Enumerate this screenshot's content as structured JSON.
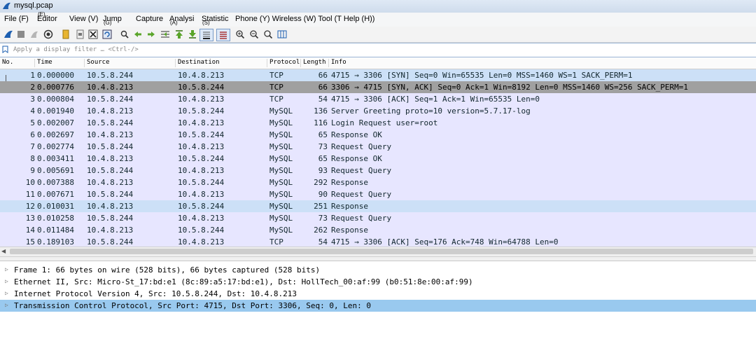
{
  "window": {
    "title": "mysql.pcap",
    "icon": "wireshark-fin-icon"
  },
  "menu": [
    {
      "label": "File (F)",
      "sub": ""
    },
    {
      "label": "Editor",
      "sub": "(E)"
    },
    {
      "label": "View (V)",
      "sub": ""
    },
    {
      "label": "Jump",
      "sub": "(G)"
    },
    {
      "label": "Capture",
      "sub": ""
    },
    {
      "label": "Analysi",
      "sub": "(A)"
    },
    {
      "label": "Statistic",
      "sub": "(S)"
    },
    {
      "label": "Phone (Y) Wireless (W) Tool (T Help (H))",
      "sub": ""
    }
  ],
  "toolbar": {
    "icons": [
      "shark-fin-icon",
      "stop-icon",
      "restart-icon",
      "capture-options-icon",
      "open-folder-icon",
      "file-icon",
      "close-file-icon",
      "reload-icon",
      "find-icon",
      "go-back-icon",
      "go-forward-icon",
      "go-to-packet-icon",
      "first-packet-icon",
      "last-packet-icon",
      "auto-scroll-icon",
      "colorize-icon",
      "zoom-in-icon",
      "zoom-out-icon",
      "normal-size-icon",
      "resize-columns-icon"
    ]
  },
  "filter": {
    "placeholder": "Apply a display filter … <Ctrl-/>",
    "value": ""
  },
  "packet_list": {
    "columns": {
      "no": "No.",
      "time": "Time",
      "source": "Source",
      "destination": "Destination",
      "protocol": "Protocol",
      "length": "Length",
      "info": "Info"
    },
    "rows": [
      {
        "no": "1",
        "time": "0.000000",
        "src": "10.5.8.244",
        "dst": "10.4.8.213",
        "proto": "TCP",
        "len": "66",
        "info": "4715 → 3306 [SYN] Seq=0 Win=65535 Len=0 MSS=1460 WS=1 SACK_PERM=1"
      },
      {
        "no": "2",
        "time": "0.000776",
        "src": "10.4.8.213",
        "dst": "10.5.8.244",
        "proto": "TCP",
        "len": "66",
        "info": "3306 → 4715 [SYN, ACK] Seq=0 Ack=1 Win=8192 Len=0 MSS=1460 WS=256 SACK_PERM=1"
      },
      {
        "no": "3",
        "time": "0.000804",
        "src": "10.5.8.244",
        "dst": "10.4.8.213",
        "proto": "TCP",
        "len": "54",
        "info": "4715 → 3306 [ACK] Seq=1 Ack=1 Win=65535 Len=0"
      },
      {
        "no": "4",
        "time": "0.001940",
        "src": "10.4.8.213",
        "dst": "10.5.8.244",
        "proto": "MySQL",
        "len": "136",
        "info": "Server Greeting proto=10 version=5.7.17-log"
      },
      {
        "no": "5",
        "time": "0.002007",
        "src": "10.5.8.244",
        "dst": "10.4.8.213",
        "proto": "MySQL",
        "len": "116",
        "info": "Login Request user=root"
      },
      {
        "no": "6",
        "time": "0.002697",
        "src": "10.4.8.213",
        "dst": "10.5.8.244",
        "proto": "MySQL",
        "len": "65",
        "info": "Response OK"
      },
      {
        "no": "7",
        "time": "0.002774",
        "src": "10.5.8.244",
        "dst": "10.4.8.213",
        "proto": "MySQL",
        "len": "73",
        "info": "Request Query"
      },
      {
        "no": "8",
        "time": "0.003411",
        "src": "10.4.8.213",
        "dst": "10.5.8.244",
        "proto": "MySQL",
        "len": "65",
        "info": "Response OK"
      },
      {
        "no": "9",
        "time": "0.005691",
        "src": "10.5.8.244",
        "dst": "10.4.8.213",
        "proto": "MySQL",
        "len": "93",
        "info": "Request Query"
      },
      {
        "no": "10",
        "time": "0.007388",
        "src": "10.4.8.213",
        "dst": "10.5.8.244",
        "proto": "MySQL",
        "len": "292",
        "info": "Response"
      },
      {
        "no": "11",
        "time": "0.007671",
        "src": "10.5.8.244",
        "dst": "10.4.8.213",
        "proto": "MySQL",
        "len": "90",
        "info": "Request Query"
      },
      {
        "no": "12",
        "time": "0.010031",
        "src": "10.4.8.213",
        "dst": "10.5.8.244",
        "proto": "MySQL",
        "len": "251",
        "info": "Response"
      },
      {
        "no": "13",
        "time": "0.010258",
        "src": "10.5.8.244",
        "dst": "10.4.8.213",
        "proto": "MySQL",
        "len": "73",
        "info": "Request Query"
      },
      {
        "no": "14",
        "time": "0.011484",
        "src": "10.4.8.213",
        "dst": "10.5.8.244",
        "proto": "MySQL",
        "len": "262",
        "info": "Response"
      },
      {
        "no": "15",
        "time": "0.189103",
        "src": "10.5.8.244",
        "dst": "10.4.8.213",
        "proto": "TCP",
        "len": "54",
        "info": "4715 → 3306 [ACK] Seq=176 Ack=748 Win=64788 Len=0"
      }
    ],
    "selected_row": "2"
  },
  "details": [
    {
      "text": "Frame 1: 66 bytes on wire (528 bits), 66 bytes captured (528 bits)"
    },
    {
      "text": "Ethernet II, Src: Micro-St_17:bd:e1 (8c:89:a5:17:bd:e1), Dst: HollTech_00:af:99 (b0:51:8e:00:af:99)"
    },
    {
      "text": "Internet Protocol Version 4, Src: 10.5.8.244, Dst: 10.4.8.213"
    },
    {
      "text": "Transmission Control Protocol, Src Port: 4715, Dst Port: 3306, Seq: 0, Len: 0"
    }
  ],
  "colors": {
    "row_tcp_mysql": "#e7e6ff",
    "row_selected": "#a0a0a0",
    "detail_selected": "#99c9ef"
  }
}
